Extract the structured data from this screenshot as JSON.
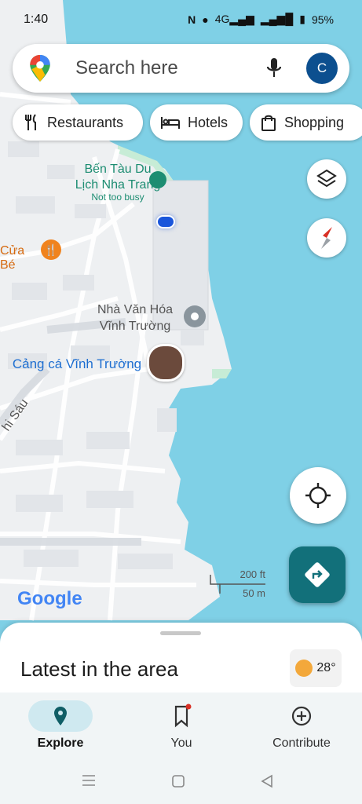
{
  "status_bar": {
    "time": "1:40",
    "battery": "95%",
    "icons": [
      "nfc-icon",
      "location-icon",
      "signal-4g-icon",
      "signal-icon",
      "battery-icon"
    ]
  },
  "search": {
    "placeholder": "Search here",
    "avatar_letter": "C"
  },
  "chips": [
    {
      "label": "Restaurants",
      "icon": "fork-knife-icon"
    },
    {
      "label": "Hotels",
      "icon": "bed-icon"
    },
    {
      "label": "Shopping",
      "icon": "shopping-bag-icon"
    }
  ],
  "map": {
    "labels": {
      "ferry": "Bến Tàu Du\nLịch Nha Trang",
      "ferry_sub": "Not too busy",
      "restaurant": "Cửa Bé",
      "culture": "Nhà Văn Hóa\nVĩnh Trường",
      "port": "Cảng cá Vĩnh Trường",
      "street": "hi Sáu"
    },
    "scale": {
      "imperial": "200 ft",
      "metric": "50 m"
    },
    "logo": "Google"
  },
  "sheet": {
    "title": "Latest in the area",
    "temperature": "28°"
  },
  "bottom_nav": [
    {
      "label": "Explore",
      "icon": "explore-pin-icon",
      "active": true
    },
    {
      "label": "You",
      "icon": "bookmark-icon",
      "active": false
    },
    {
      "label": "Contribute",
      "icon": "add-circle-icon",
      "active": false
    }
  ],
  "colors": {
    "water": "#7fd0e6",
    "land": "#eef0f2",
    "accent": "#12707a",
    "avatar": "#0c4f8f",
    "port_label": "#1f6fd1",
    "ferry_label": "#1d8d72"
  }
}
